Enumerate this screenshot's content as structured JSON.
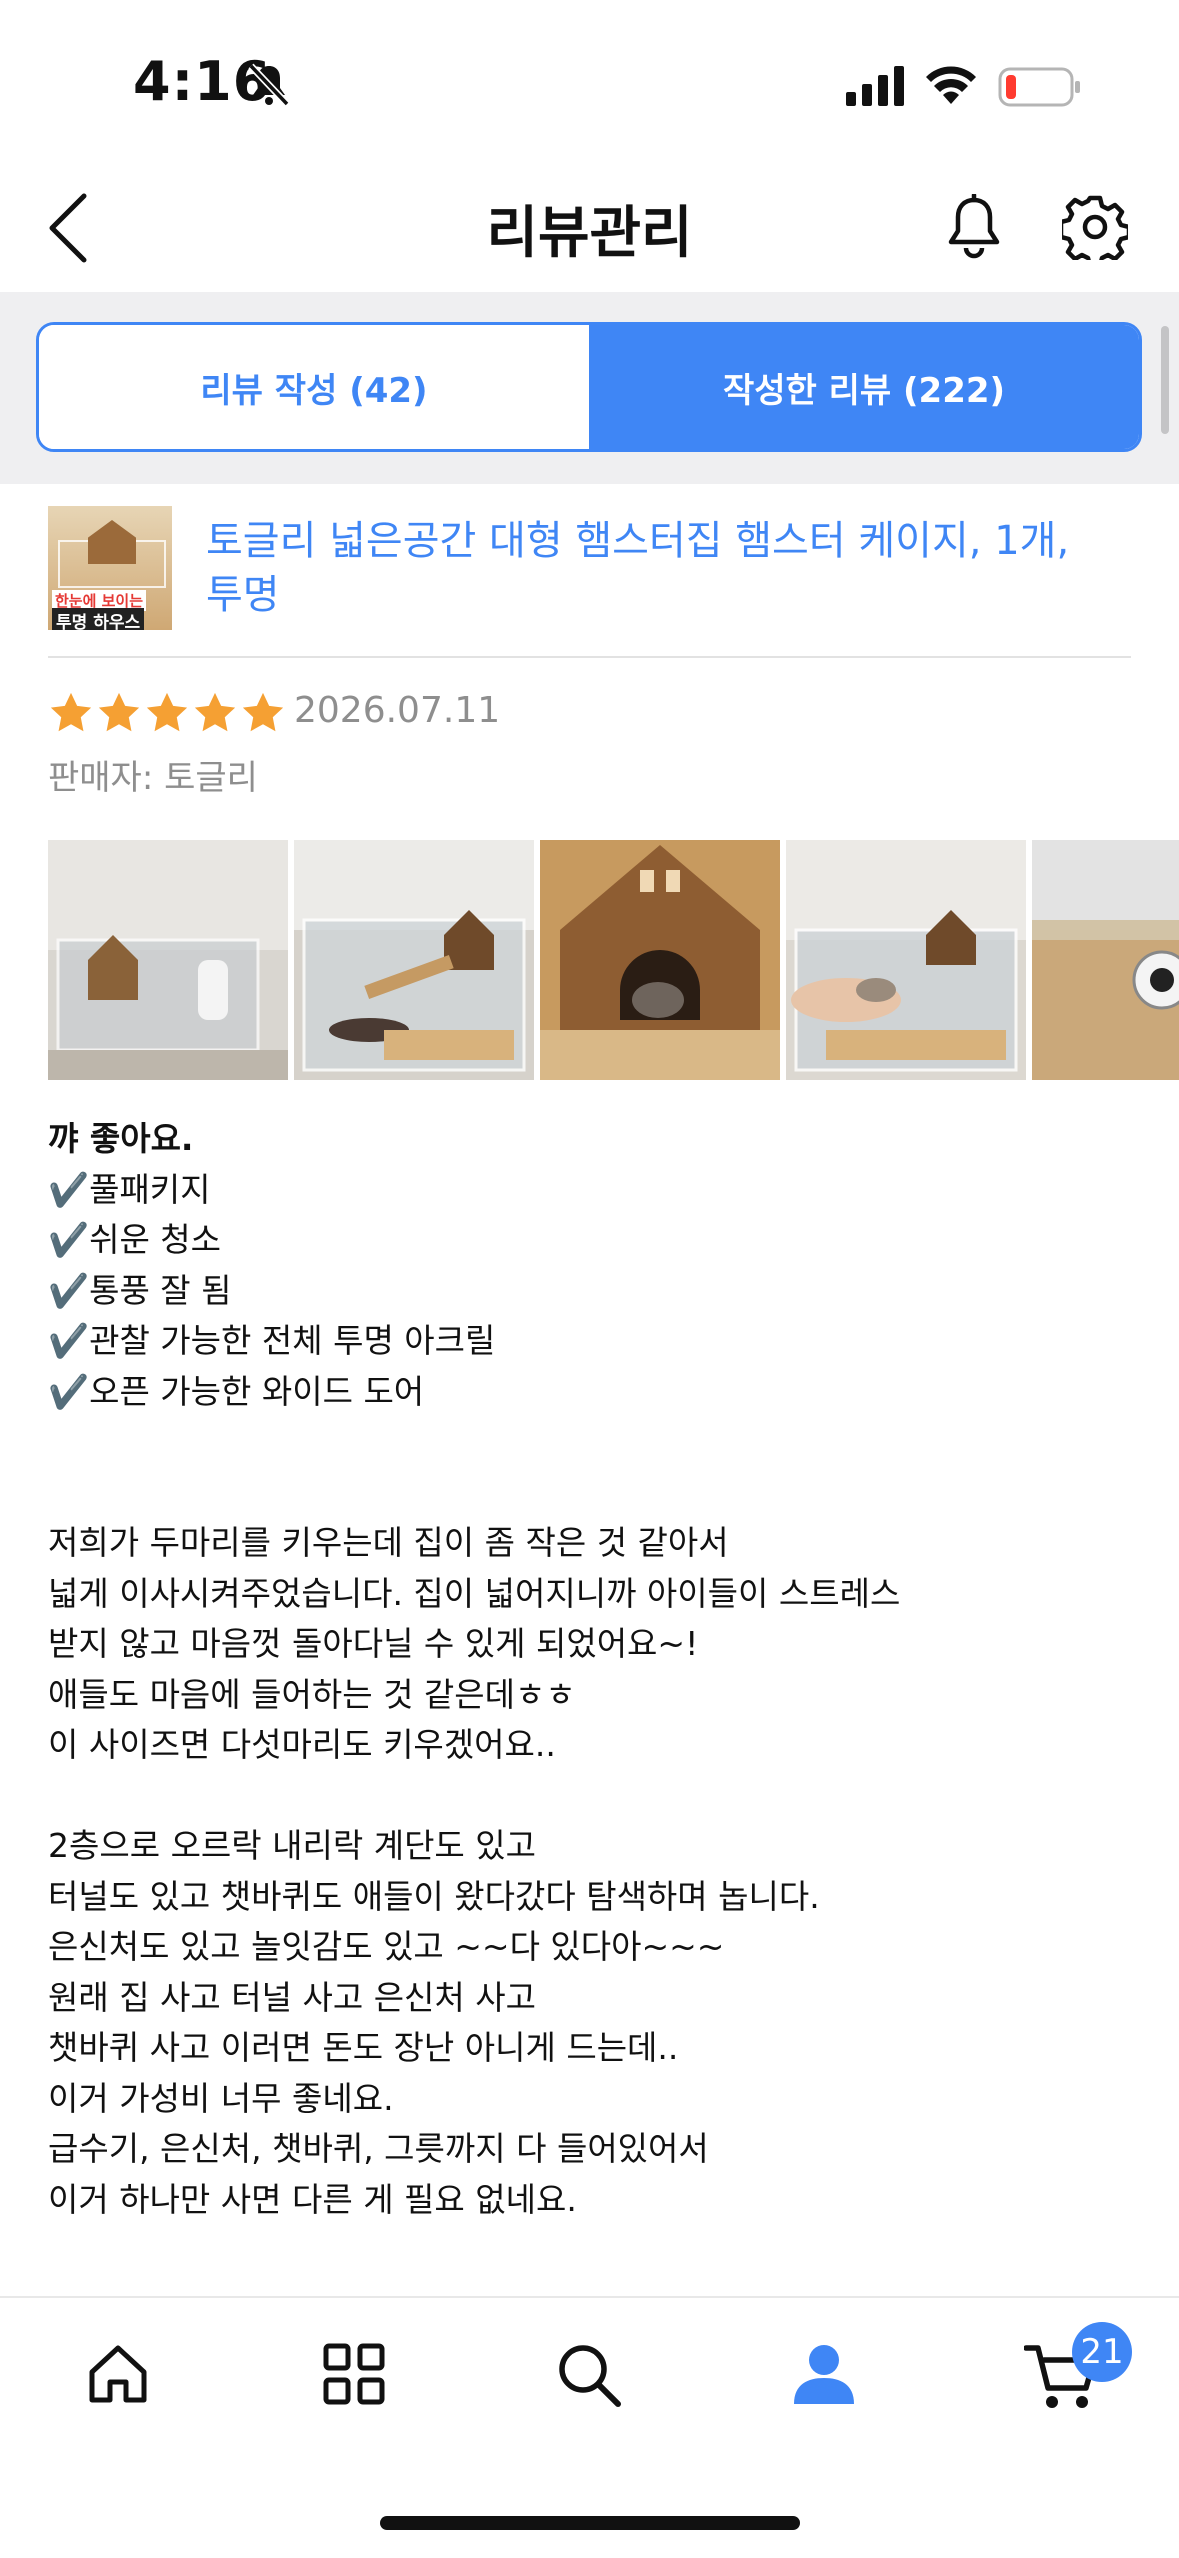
{
  "status_bar": {
    "time": "4:16"
  },
  "nav": {
    "title": "리뷰관리"
  },
  "tabs": [
    {
      "label": "리뷰 작성 (42)",
      "active": false
    },
    {
      "label": "작성한 리뷰 (222)",
      "active": true
    }
  ],
  "product": {
    "title": "토글리 넓은공간 대형 햄스터집 햄스터 케이지, 1개, 투명",
    "thumb_text_1": "한눈에 보이는",
    "thumb_text_2": "투명 하우스"
  },
  "review": {
    "rating": 5,
    "date": "2026.07.11",
    "seller": "판매자: 토글리",
    "heading": "꺄 좋아요.",
    "body": "✔️풀패키지\n✔️쉬운 청소\n✔️통풍 잘 됨\n✔️관찰 가능한 전체 투명 아크릴\n✔️오픈 가능한 와이드 도어\n\n\n저희가 두마리를 키우는데 집이 좀 작은 것 같아서\n넓게 이사시켜주었습니다. 집이 넓어지니까 아이들이 스트레스\n받지 않고 마음껏 돌아다닐 수 있게 되었어요~!\n애들도 마음에 들어하는 것 같은데ㅎㅎ\n이 사이즈면 다섯마리도 키우겠어요..\n\n2층으로 오르락 내리락 계단도 있고\n터널도 있고 챗바퀴도 애들이 왔다갔다 탐색하며 놉니다.\n은신처도 있고 놀잇감도 있고 ~~다 있다아~~~\n원래 집 사고 터널 사고 은신처 사고\n챗바퀴 사고 이러면 돈도 장난 아니게 드는데..\n이거 가성비 너무 좋네요.\n급수기, 은신처, 챗바퀴, 그릇까지 다 들어있어서\n이거 하나만 사면 다른 게 필요 없네요."
  },
  "bottom_tabs": {
    "items": [
      "home-icon",
      "category-grid-icon",
      "search-icon",
      "profile-icon",
      "cart-icon"
    ],
    "active": "profile-icon",
    "cart_count": "21"
  },
  "colors": {
    "accent": "#3f86f5",
    "star": "#f5a033",
    "muted": "#8e8e8e"
  }
}
